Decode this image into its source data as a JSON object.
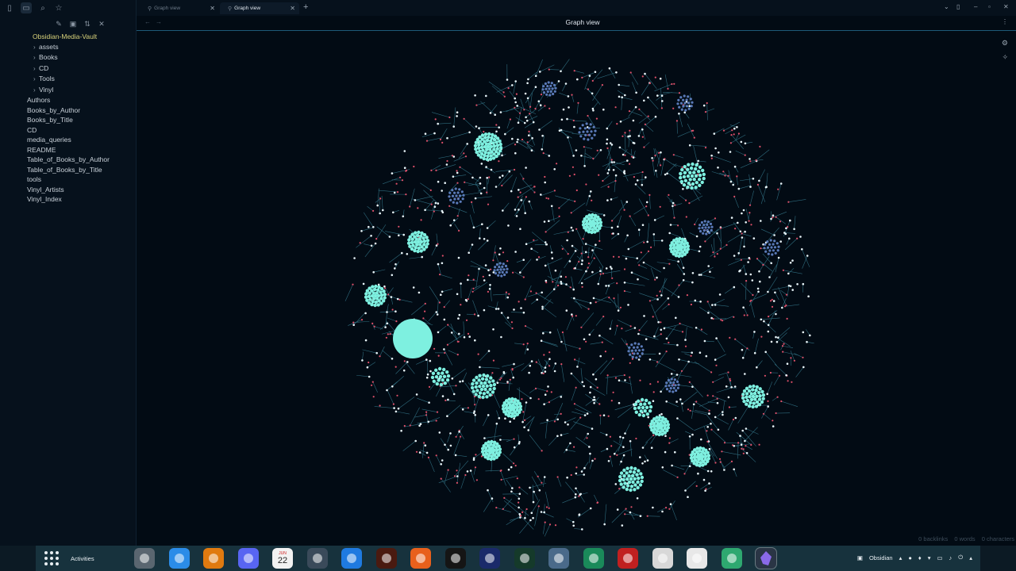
{
  "sidebar": {
    "vault_name": "Obsidian-Media-Vault",
    "folders": [
      {
        "label": "assets"
      },
      {
        "label": "Books"
      },
      {
        "label": "CD"
      },
      {
        "label": "Tools"
      },
      {
        "label": "Vinyl"
      }
    ],
    "files": [
      {
        "label": "Authors"
      },
      {
        "label": "Books_by_Author"
      },
      {
        "label": "Books_by_Title"
      },
      {
        "label": "CD"
      },
      {
        "label": "media_queries"
      },
      {
        "label": "README"
      },
      {
        "label": "Table_of_Books_by_Author"
      },
      {
        "label": "Table_of_Books_by_Title"
      },
      {
        "label": "tools"
      },
      {
        "label": "Vinyl_Artists"
      },
      {
        "label": "Vinyl_Index"
      }
    ]
  },
  "tabs": [
    {
      "label": "Graph view",
      "active": false
    },
    {
      "label": "Graph view",
      "active": true
    }
  ],
  "view": {
    "title": "Graph view"
  },
  "graph": {
    "node_colors": {
      "note": "#e8f4f8",
      "tag": "#e0506a",
      "hub": "#7ef0e0",
      "link": "#2e6a7c"
    }
  },
  "status": {
    "backlinks": "0 backlinks",
    "words": "0 words",
    "characters": "0 characters"
  },
  "dock": {
    "activities": "Activities",
    "calendar_month": "JUN",
    "calendar_day": "22",
    "active_app": "Obsidian",
    "apps": [
      {
        "name": "settings-app-icon",
        "color": "#5a6670"
      },
      {
        "name": "finder-app-icon",
        "color": "#2b8ce8"
      },
      {
        "name": "sunflower-app-icon",
        "color": "#e07a10"
      },
      {
        "name": "discord-app-icon",
        "color": "#5865f2"
      },
      {
        "name": "calendar-app-icon",
        "color": "#f2f2f2"
      },
      {
        "name": "shuttle-app-icon",
        "color": "#3a4a5a"
      },
      {
        "name": "screenshot-app-icon",
        "color": "#1f7ae0"
      },
      {
        "name": "game-app-icon",
        "color": "#4a1a10"
      },
      {
        "name": "firefox-app-icon",
        "color": "#e8601c"
      },
      {
        "name": "cat-app-icon",
        "color": "#151515"
      },
      {
        "name": "x-app-icon",
        "color": "#1a2a6a"
      },
      {
        "name": "bull-app-icon",
        "color": "#153a2a"
      },
      {
        "name": "editor-app-icon",
        "color": "#4a6a8a"
      },
      {
        "name": "clock-app-icon",
        "color": "#1a8a5a"
      },
      {
        "name": "filezilla-app-icon",
        "color": "#c02020"
      },
      {
        "name": "search-app-icon",
        "color": "#d8d8d8"
      },
      {
        "name": "paw-app-icon",
        "color": "#e8e8e8"
      },
      {
        "name": "atom-app-icon",
        "color": "#2ea870"
      },
      {
        "name": "obsidian-app-icon",
        "color": "#7a5ad8"
      }
    ]
  }
}
